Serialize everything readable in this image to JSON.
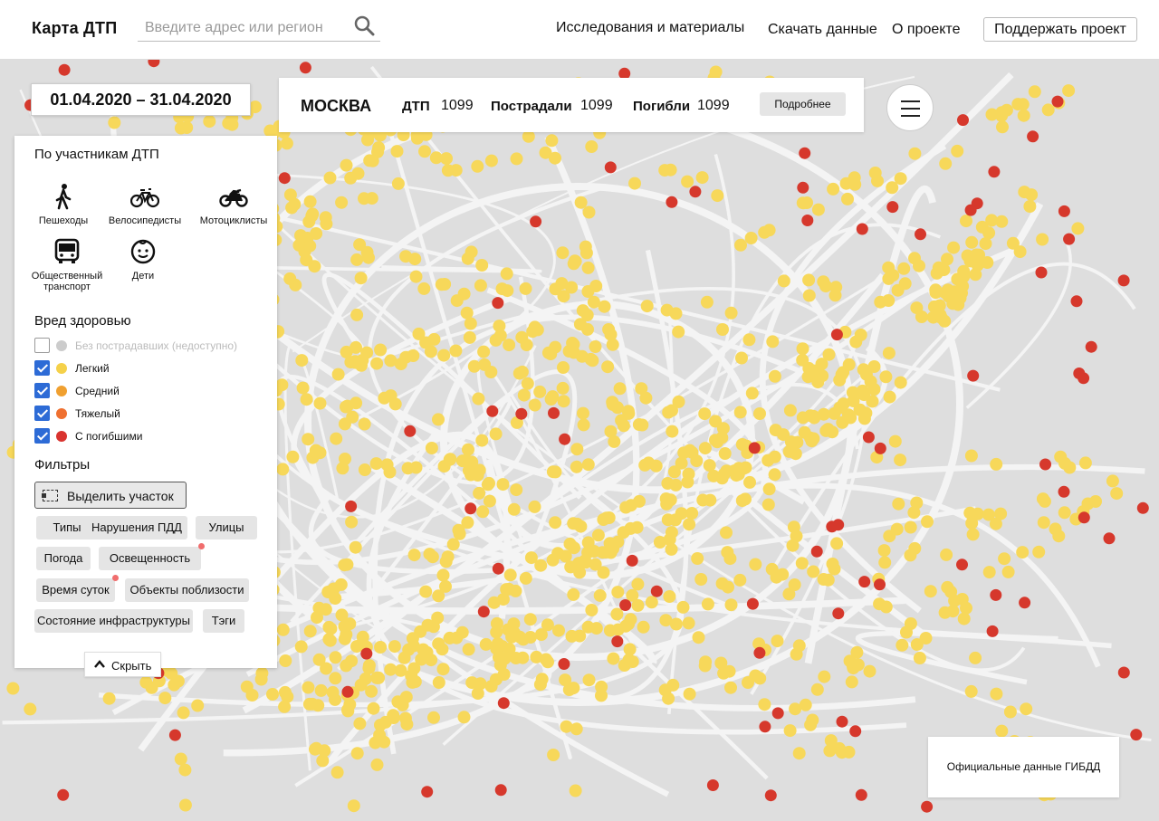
{
  "header": {
    "brand": "Карта ДТП",
    "search_placeholder": "Введите адрес или регион",
    "nav": [
      "Исследования и материалы",
      "Скачать данные",
      "О проекте"
    ],
    "support": "Поддержать проект"
  },
  "date_range": "01.04.2020 – 31.04.2020",
  "stats": {
    "city": "МОСКВА",
    "dtp_label": "ДТП",
    "dtp_value": "1099",
    "injured_label": "Пострадали",
    "injured_value": "1099",
    "killed_label": "Погибли",
    "killed_value": "1099",
    "more": "Подробнее"
  },
  "panel": {
    "participants_title": "По участникам ДТП",
    "participants": [
      {
        "label": "Пешеходы",
        "icon": "pedestrian-icon"
      },
      {
        "label": "Велосипедисты",
        "icon": "bicycle-icon"
      },
      {
        "label": "Мотоциклисты",
        "icon": "motorcycle-icon"
      },
      {
        "label": "Общественный транспорт",
        "icon": "bus-icon"
      },
      {
        "label": "Дети",
        "icon": "child-face-icon"
      }
    ],
    "harm_title": "Вред здоровью",
    "harm": [
      {
        "label": "Без пострадавших (недоступно)",
        "checked": false,
        "disabled": true,
        "color": "#cccccc"
      },
      {
        "label": "Легкий",
        "checked": true,
        "disabled": false,
        "color": "#f5d14a"
      },
      {
        "label": "Средний",
        "checked": true,
        "disabled": false,
        "color": "#f0a030"
      },
      {
        "label": "Тяжелый",
        "checked": true,
        "disabled": false,
        "color": "#ef7030"
      },
      {
        "label": "С погибшими",
        "checked": true,
        "disabled": false,
        "color": "#d9332f"
      }
    ],
    "filters_title": "Фильтры",
    "select_area": "Выделить участок",
    "chips": [
      "Типы",
      "Нарушения ПДД",
      "Улицы",
      "Погода",
      "Освещенность",
      "Время суток",
      "Объекты поблизости",
      "Состояние инфраструктуры",
      "Тэги"
    ],
    "hide": "Скрыть"
  },
  "official_data": "Официальные данные ГИБДД",
  "colors": {
    "light": "#f7d85a",
    "fatal": "#d6382c",
    "checkbox": "#2d6bd6"
  }
}
